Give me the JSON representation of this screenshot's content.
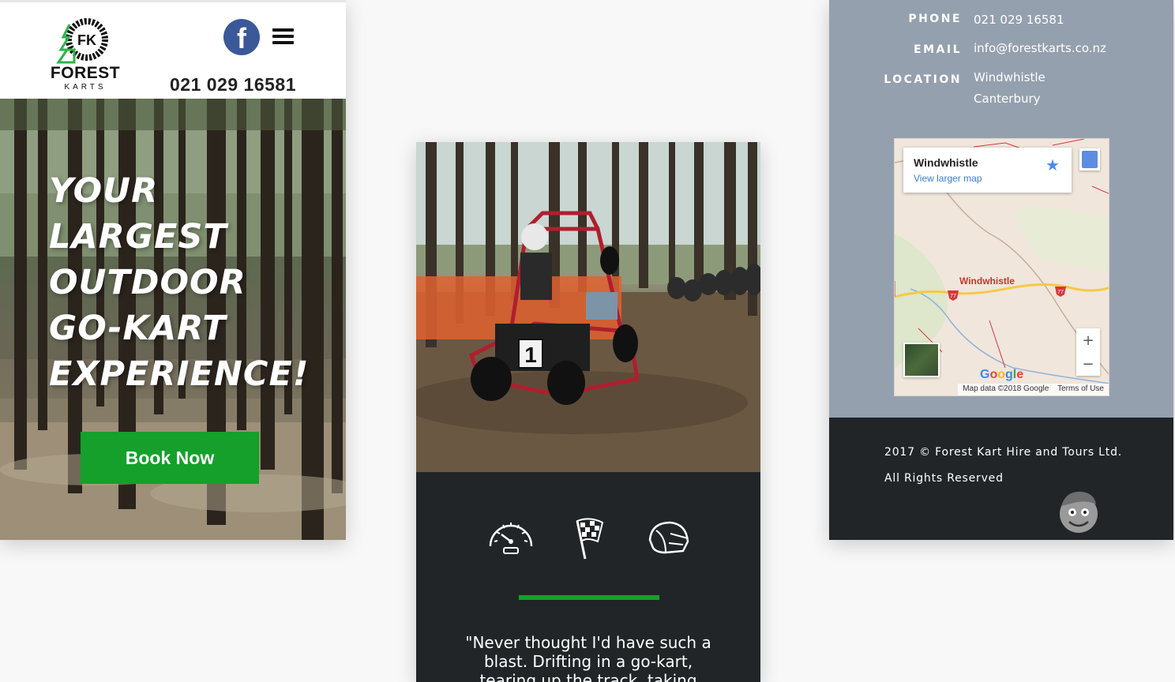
{
  "header": {
    "logo_initials": "FK",
    "logo_name": "FOREST",
    "logo_sub": "KARTS",
    "phone": "021 029 16581",
    "social_icon": "facebook-icon",
    "menu_icon": "hamburger-menu-icon"
  },
  "hero": {
    "headline_lines": [
      "YOUR",
      "LARGEST",
      "OUTDOOR",
      "GO-KART",
      "EXPERIENCE!"
    ],
    "cta_label": "Book Now"
  },
  "features": {
    "icons": [
      "speedometer-icon",
      "checkered-flag-icon",
      "helmet-icon"
    ],
    "kart_number": "1",
    "quote": "\"Never thought I'd have such a blast. Drifting in a go-kart, tearing up the track, taking"
  },
  "contact": {
    "phone_label": "PHONE",
    "phone_value": "021 029 16581",
    "email_label": "EMAIL",
    "email_value": "info@forestkarts.co.nz",
    "location_label": "LOCATION",
    "location_line1": "Windwhistle",
    "location_line2": "Canterbury"
  },
  "map": {
    "place_title": "Windwhistle",
    "view_larger": "View larger map",
    "town_label": "Windwhistle",
    "route_badge": "77",
    "zoom_in": "+",
    "zoom_out": "−",
    "google": "Google",
    "attribution": "Map data ©2018 Google",
    "terms": "Terms of Use"
  },
  "footer": {
    "copyright": "2017 © Forest Kart Hire and Tours Ltd.",
    "rights": "All Rights Reserved"
  },
  "colors": {
    "brand_green": "#14a02a",
    "dark": "#212528",
    "slate": "#95a0ae",
    "facebook_blue": "#3b5998"
  }
}
